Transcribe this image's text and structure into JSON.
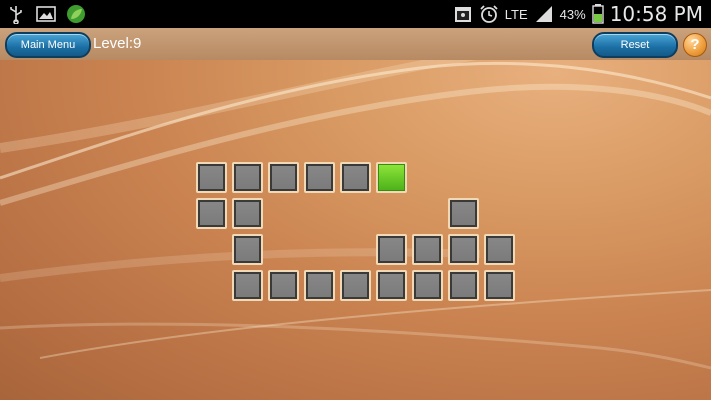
{
  "status_bar": {
    "battery_percent": "43%",
    "network": "LTE",
    "time": "10:58 PM",
    "icons": [
      "usb-icon",
      "image-icon",
      "leaf-icon",
      "calendar-icon",
      "alarm-icon",
      "signal-icon",
      "battery-icon"
    ]
  },
  "toolbar": {
    "main_menu_label": "Main Menu",
    "level_text": "Level:9",
    "reset_label": "Reset",
    "help_label": "?"
  },
  "colors": {
    "button_blue": "#1b6fa4",
    "tile_gray": "#7a7a7a",
    "tile_green": "#5cc51f",
    "background_orange": "#c98250"
  },
  "grid": {
    "columns": 9,
    "rows": 4,
    "tiles": [
      {
        "row": 0,
        "col": 0,
        "state": "gray"
      },
      {
        "row": 0,
        "col": 1,
        "state": "gray"
      },
      {
        "row": 0,
        "col": 2,
        "state": "gray"
      },
      {
        "row": 0,
        "col": 3,
        "state": "gray"
      },
      {
        "row": 0,
        "col": 4,
        "state": "gray"
      },
      {
        "row": 0,
        "col": 5,
        "state": "green"
      },
      {
        "row": 1,
        "col": 0,
        "state": "gray"
      },
      {
        "row": 1,
        "col": 1,
        "state": "gray"
      },
      {
        "row": 1,
        "col": 7,
        "state": "gray"
      },
      {
        "row": 2,
        "col": 1,
        "state": "gray"
      },
      {
        "row": 2,
        "col": 5,
        "state": "gray"
      },
      {
        "row": 2,
        "col": 6,
        "state": "gray"
      },
      {
        "row": 2,
        "col": 7,
        "state": "gray"
      },
      {
        "row": 2,
        "col": 8,
        "state": "gray"
      },
      {
        "row": 3,
        "col": 1,
        "state": "gray"
      },
      {
        "row": 3,
        "col": 2,
        "state": "gray"
      },
      {
        "row": 3,
        "col": 3,
        "state": "gray"
      },
      {
        "row": 3,
        "col": 4,
        "state": "gray"
      },
      {
        "row": 3,
        "col": 5,
        "state": "gray"
      },
      {
        "row": 3,
        "col": 6,
        "state": "gray"
      },
      {
        "row": 3,
        "col": 7,
        "state": "gray"
      },
      {
        "row": 3,
        "col": 8,
        "state": "gray"
      }
    ]
  }
}
